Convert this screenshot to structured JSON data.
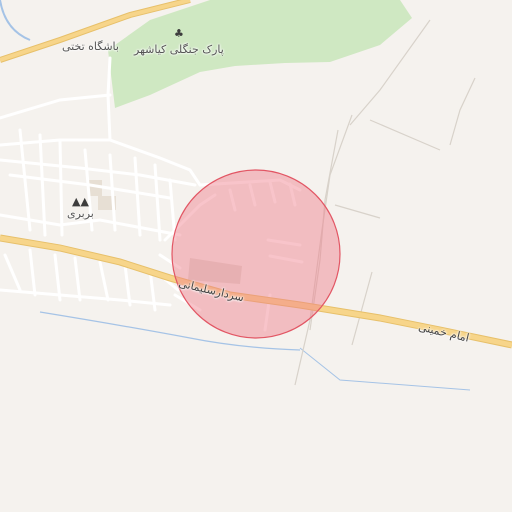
{
  "map": {
    "colors": {
      "land": "#f5f2ee",
      "park": "#cfe8c2",
      "major_road": "#f7d58a",
      "minor_road": "#ffffff",
      "water": "#a5c3e6",
      "circle_fill": "#f07c8a",
      "circle_stroke": "#e25664"
    },
    "labels": {
      "park": "پارک جنگلی کیاشهر",
      "club": "باشگاه تختی",
      "village": "بربری",
      "road_west": "سردارسلیمانی",
      "road_east": "امام خمینی"
    },
    "icons": {
      "park": "tree-icon",
      "village": "village-icon"
    }
  }
}
